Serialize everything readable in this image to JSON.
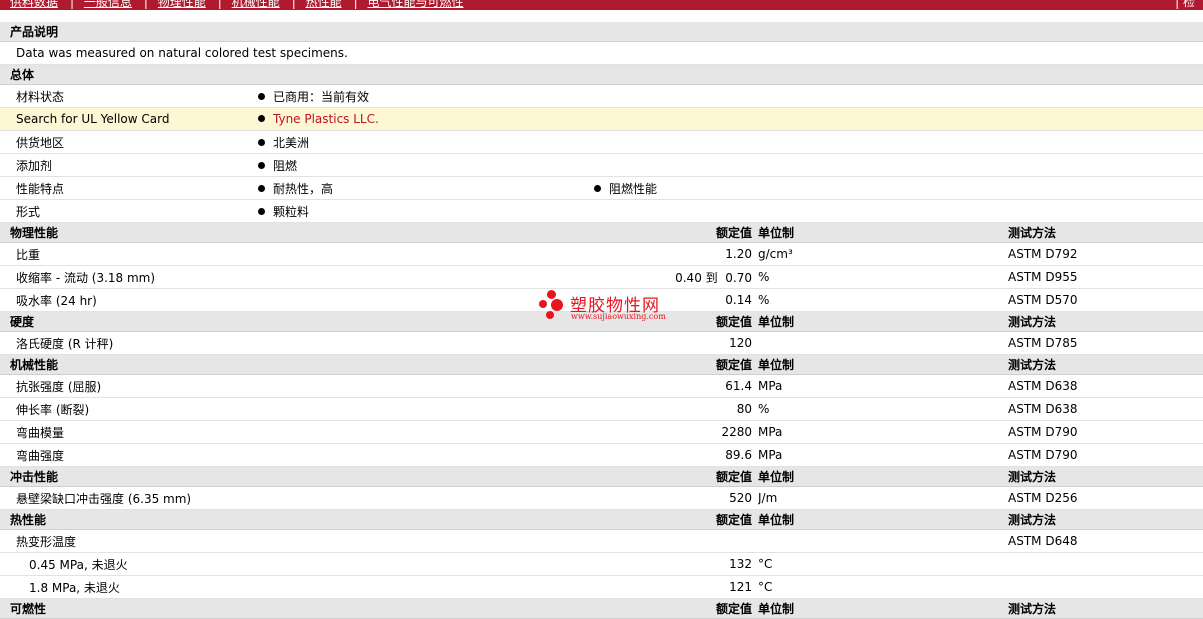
{
  "topbar": {
    "nav": [
      "供料数据",
      "一般信息",
      "物理性能",
      "机械性能",
      "热性能",
      "电气性能与可燃性"
    ],
    "right": "| 检"
  },
  "sections": {
    "product_desc": {
      "title": "产品说明",
      "text": "Data was measured on natural colored test specimens."
    },
    "general": {
      "title": "总体",
      "rows": [
        {
          "label": "材料状态",
          "values": [
            "已商用：当前有效"
          ]
        },
        {
          "label": "Search for UL Yellow Card",
          "values": [
            "Tyne Plastics LLC."
          ]
        },
        {
          "label": "供货地区",
          "values": [
            "北美洲"
          ]
        },
        {
          "label": "添加剂",
          "values": [
            "阻燃"
          ]
        },
        {
          "label": "性能特点",
          "values": [
            "耐热性，高",
            "阻燃性能"
          ]
        },
        {
          "label": "形式",
          "values": [
            "颗粒料"
          ]
        }
      ]
    },
    "col_headers": {
      "nominal": "额定值",
      "unit": "单位制",
      "method": "测试方法"
    },
    "physical": {
      "title": "物理性能",
      "rows": [
        {
          "label": "比重",
          "value": "1.20",
          "unit": "g/cm³",
          "method": "ASTM D792"
        },
        {
          "label": "收缩率 - 流动 (3.18 mm)",
          "value": "0.40 到  0.70",
          "unit": "%",
          "method": "ASTM D955"
        },
        {
          "label": "吸水率 (24 hr)",
          "value": "0.14",
          "unit": "%",
          "method": "ASTM D570"
        }
      ]
    },
    "hardness": {
      "title": "硬度",
      "rows": [
        {
          "label": "洛氏硬度 (R 计秤)",
          "value": "120",
          "unit": "",
          "method": "ASTM D785"
        }
      ]
    },
    "mechanical": {
      "title": "机械性能",
      "rows": [
        {
          "label": "抗张强度 (屈服)",
          "value": "61.4",
          "unit": "MPa",
          "method": "ASTM D638"
        },
        {
          "label": "伸长率 (断裂)",
          "value": "80",
          "unit": "%",
          "method": "ASTM D638"
        },
        {
          "label": "弯曲模量",
          "value": "2280",
          "unit": "MPa",
          "method": "ASTM D790"
        },
        {
          "label": "弯曲强度",
          "value": "89.6",
          "unit": "MPa",
          "method": "ASTM D790"
        }
      ]
    },
    "impact": {
      "title": "冲击性能",
      "rows": [
        {
          "label": "悬壁梁缺口冲击强度 (6.35 mm)",
          "value": "520",
          "unit": "J/m",
          "method": "ASTM D256"
        }
      ]
    },
    "thermal": {
      "title": "热性能",
      "rows": [
        {
          "label": "热变形温度",
          "value": "",
          "unit": "",
          "method": "ASTM D648"
        },
        {
          "label": "0.45 MPa, 未退火",
          "value": "132",
          "unit": "°C",
          "method": ""
        },
        {
          "label": "1.8 MPa, 未退火",
          "value": "121",
          "unit": "°C",
          "method": ""
        }
      ]
    },
    "flammability": {
      "title": "可燃性"
    }
  },
  "watermark": {
    "title": "塑胶物性网",
    "url": "www.sujiaowuxing.com",
    "color": "#e8141f"
  }
}
